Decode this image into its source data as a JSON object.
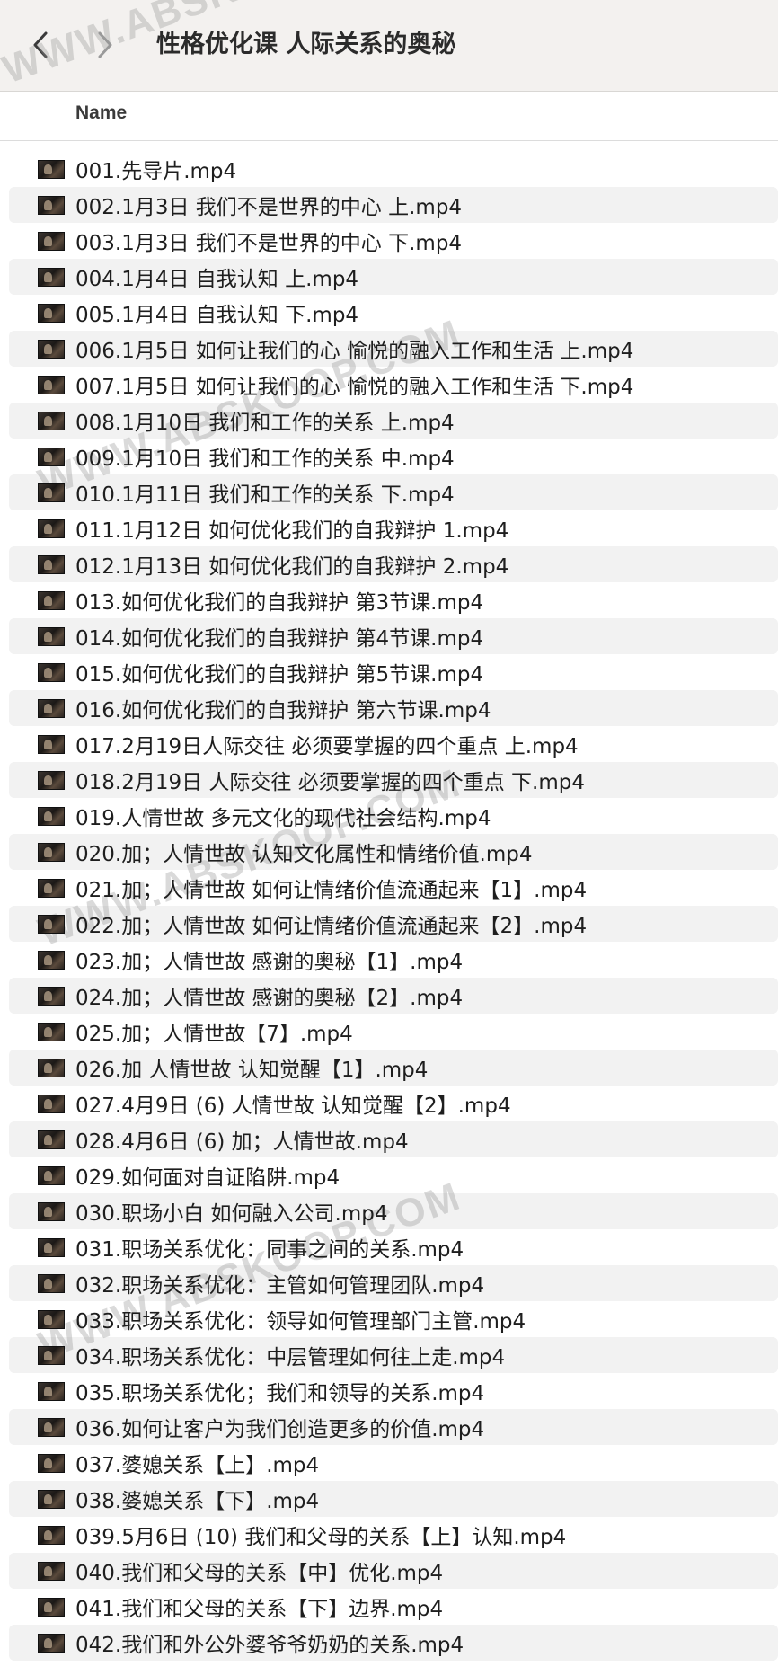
{
  "window": {
    "title": "性格优化课 人际关系的奥秘"
  },
  "toolbar": {
    "back_icon": "chevron-left-icon",
    "forward_icon": "chevron-right-icon"
  },
  "header": {
    "name_column": "Name"
  },
  "files": [
    "001.先导片.mp4",
    "002.1月3日 我们不是世界的中心 上.mp4",
    "003.1月3日 我们不是世界的中心 下.mp4",
    "004.1月4日 自我认知 上.mp4",
    "005.1月4日 自我认知 下.mp4",
    "006.1月5日 如何让我们的心 愉悦的融入工作和生活  上.mp4",
    "007.1月5日 如何让我们的心 愉悦的融入工作和生活 下.mp4",
    "008.1月10日 我们和工作的关系 上.mp4",
    "009.1月10日 我们和工作的关系  中.mp4",
    "010.1月11日 我们和工作的关系 下.mp4",
    "011.1月12日 如何优化我们的自我辩护 1.mp4",
    "012.1月13日 如何优化我们的自我辩护 2.mp4",
    "013.如何优化我们的自我辩护  第3节课.mp4",
    "014.如何优化我们的自我辩护 第4节课.mp4",
    "015.如何优化我们的自我辩护 第5节课.mp4",
    "016.如何优化我们的自我辩护 第六节课.mp4",
    "017.2月19日人际交往 必须要掌握的四个重点 上.mp4",
    "018.2月19日 人际交往 必须要掌握的四个重点 下.mp4",
    "019.人情世故 多元文化的现代社会结构.mp4",
    "020.加；人情世故 认知文化属性和情绪价值.mp4",
    "021.加；人情世故 如何让情绪价值流通起来【1】.mp4",
    "022.加；人情世故 如何让情绪价值流通起来【2】.mp4",
    "023.加；人情世故 感谢的奥秘【1】.mp4",
    "024.加；人情世故  感谢的奥秘【2】.mp4",
    "025.加；人情世故【7】.mp4",
    "026.加 人情世故 认知觉醒【1】.mp4",
    "027.4月9日 (6) 人情世故 认知觉醒【2】.mp4",
    "028.4月6日 (6) 加；人情世故.mp4",
    "029.如何面对自证陷阱.mp4",
    "030.职场小白 如何融入公司.mp4",
    "031.职场关系优化：同事之间的关系.mp4",
    "032.职场关系优化：主管如何管理团队.mp4",
    "033.职场关系优化：领导如何管理部门主管.mp4",
    "034.职场关系优化：中层管理如何往上走.mp4",
    "035.职场关系优化；我们和领导的关系.mp4",
    "036.如何让客户为我们创造更多的价值.mp4",
    "037.婆媳关系【上】.mp4",
    "038.婆媳关系【下】.mp4",
    "039.5月6日 (10) 我们和父母的关系【上】认知.mp4",
    "040.我们和父母的关系【中】优化.mp4",
    "041.我们和父母的关系【下】边界.mp4",
    "042.我们和外公外婆爷爷奶奶的关系.mp4"
  ],
  "file_icon": "video-thumbnail-icon",
  "watermark": {
    "text": "WWW.ABSKOOP.COM"
  },
  "colors": {
    "toolbar_bg": "#f3f1ef",
    "row_alt_bg": "#f2f2f2"
  }
}
